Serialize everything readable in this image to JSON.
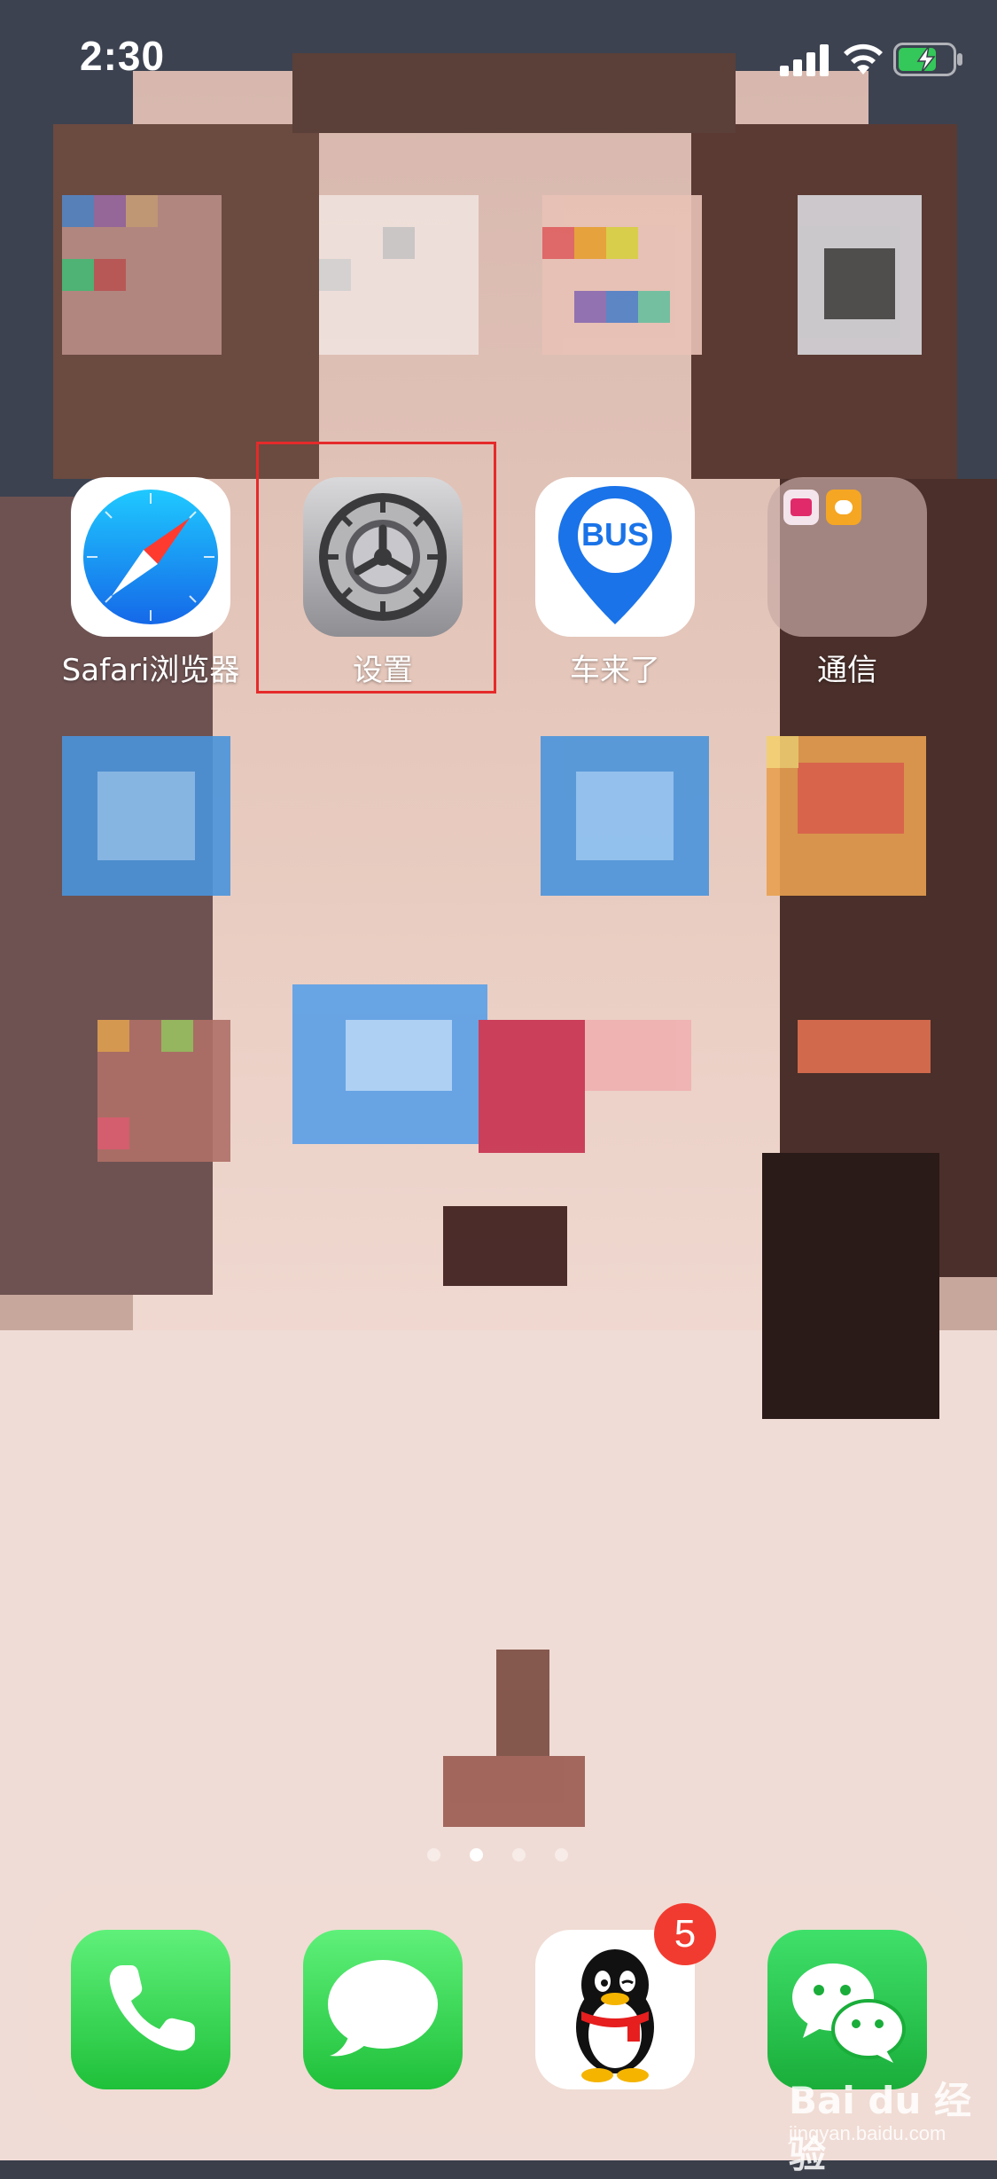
{
  "status_bar": {
    "time": "2:30"
  },
  "row1_apps": [
    {
      "name": "Safari浏览器",
      "icon": "compass-icon"
    },
    {
      "name": "设置",
      "icon": "gear-icon"
    },
    {
      "name": "车来了",
      "icon": "bus-pin-icon",
      "icon_text": "BUS"
    },
    {
      "name": "通信",
      "icon": "folder-icon"
    }
  ],
  "highlighted_app": "设置",
  "page_indicator": {
    "pages": 4,
    "current": 2
  },
  "dock": {
    "apps": [
      {
        "icon": "phone-icon"
      },
      {
        "icon": "messages-icon"
      },
      {
        "icon": "qq-penguin-icon",
        "badge": "5"
      },
      {
        "icon": "wechat-icon"
      }
    ]
  },
  "watermark": {
    "brand": "Bai du 经验",
    "url": "jingyan.baidu.com"
  },
  "colors": {
    "highlight": "#e52a2a",
    "badge": "#f23b30",
    "bus_blue": "#1a73e8",
    "green": "#2fd158"
  }
}
